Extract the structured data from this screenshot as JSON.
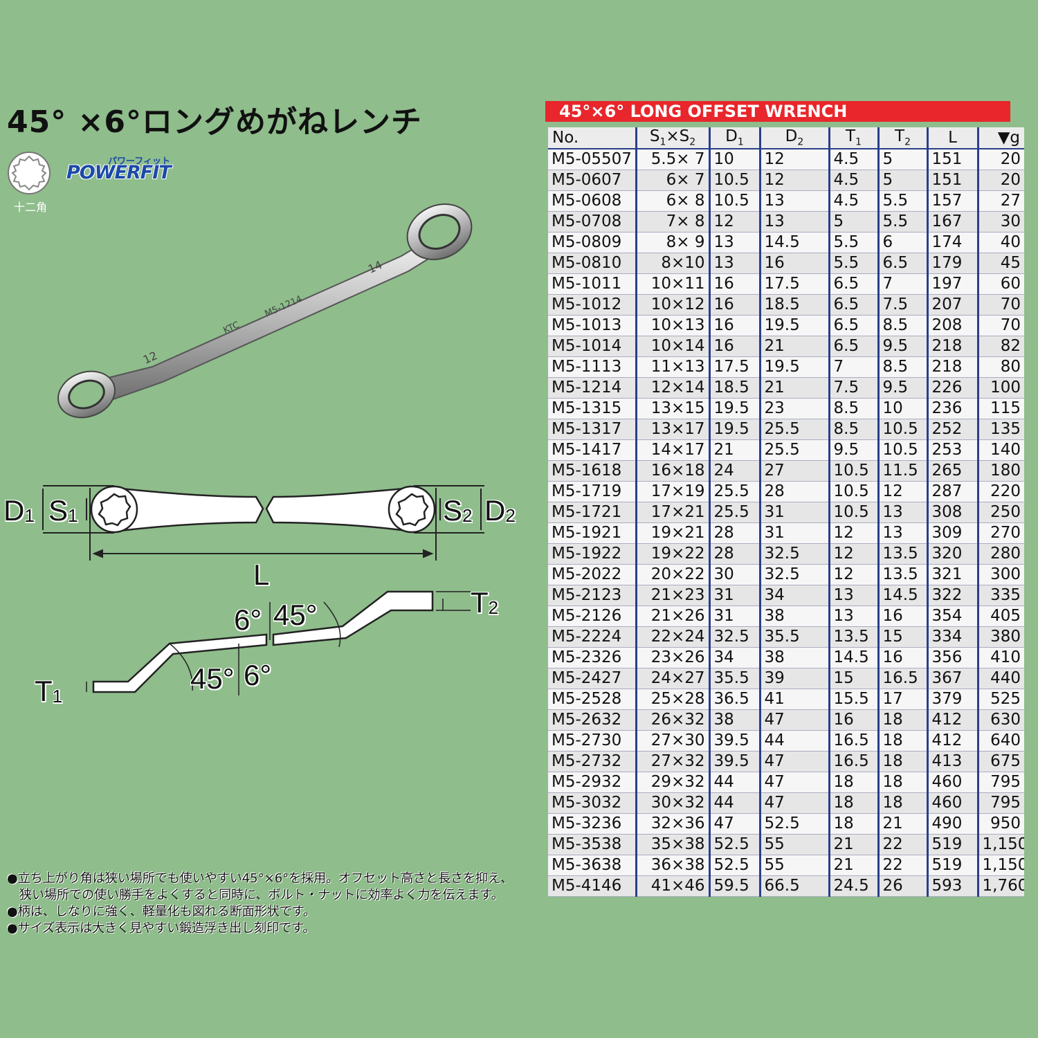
{
  "title": "45° ×6°ロングめがねレンチ",
  "twelve_point_label": "十二角",
  "brand": {
    "name": "POWERFIT",
    "kana": "パワーフィット"
  },
  "photo_markings": {
    "small_end": "12",
    "large_end": "14",
    "brand": "KTC",
    "model": "M5-1214"
  },
  "diagram": {
    "D1": "D",
    "D1_sub": "1",
    "S1": "S",
    "S1_sub": "1",
    "S2": "S",
    "S2_sub": "2",
    "D2": "D",
    "D2_sub": "2",
    "L": "L",
    "T1": "T",
    "T1_sub": "1",
    "T2": "T",
    "T2_sub": "2",
    "angle_6_top": "6°",
    "angle_45_top": "45°",
    "angle_45_bottom": "45°",
    "angle_6_bottom": "6°"
  },
  "notes": [
    "●立ち上がり角は狭い場所でも使いやすい45°×6°を採用。オフセット高さと長さを抑え、",
    "　狭い場所での使い勝手をよくすると同時に、ボルト・ナットに効率よく力を伝えます。",
    "●柄は、しなりに強く、軽量化も図れる断面形状です。",
    "●サイズ表示は大きく見やすい鍛造浮き出し刻印です。"
  ],
  "spec": {
    "header": "45°×6° LONG OFFSET WRENCH",
    "columns": [
      {
        "main": "No.",
        "sub": ""
      },
      {
        "main": "S",
        "sub": "1",
        "main2": "×S",
        "sub2": "2"
      },
      {
        "main": "D",
        "sub": "1"
      },
      {
        "main": "D",
        "sub": "2"
      },
      {
        "main": "T",
        "sub": "1"
      },
      {
        "main": "T",
        "sub": "2"
      },
      {
        "main": "L",
        "sub": ""
      },
      {
        "main": "▼g",
        "sub": ""
      }
    ],
    "rows": [
      [
        "M5-05507",
        "5.5× 7",
        "10",
        "12",
        "4.5",
        "5",
        "151",
        "20"
      ],
      [
        "M5-0607",
        "6× 7",
        "10.5",
        "12",
        "4.5",
        "5",
        "151",
        "20"
      ],
      [
        "M5-0608",
        "6× 8",
        "10.5",
        "13",
        "4.5",
        "5.5",
        "157",
        "27"
      ],
      [
        "M5-0708",
        "7× 8",
        "12",
        "13",
        "5",
        "5.5",
        "167",
        "30"
      ],
      [
        "M5-0809",
        "8× 9",
        "13",
        "14.5",
        "5.5",
        "6",
        "174",
        "40"
      ],
      [
        "M5-0810",
        "8×10",
        "13",
        "16",
        "5.5",
        "6.5",
        "179",
        "45"
      ],
      [
        "M5-1011",
        "10×11",
        "16",
        "17.5",
        "6.5",
        "7",
        "197",
        "60"
      ],
      [
        "M5-1012",
        "10×12",
        "16",
        "18.5",
        "6.5",
        "7.5",
        "207",
        "70"
      ],
      [
        "M5-1013",
        "10×13",
        "16",
        "19.5",
        "6.5",
        "8.5",
        "208",
        "70"
      ],
      [
        "M5-1014",
        "10×14",
        "16",
        "21",
        "6.5",
        "9.5",
        "218",
        "82"
      ],
      [
        "M5-1113",
        "11×13",
        "17.5",
        "19.5",
        "7",
        "8.5",
        "218",
        "80"
      ],
      [
        "M5-1214",
        "12×14",
        "18.5",
        "21",
        "7.5",
        "9.5",
        "226",
        "100"
      ],
      [
        "M5-1315",
        "13×15",
        "19.5",
        "23",
        "8.5",
        "10",
        "236",
        "115"
      ],
      [
        "M5-1317",
        "13×17",
        "19.5",
        "25.5",
        "8.5",
        "10.5",
        "252",
        "135"
      ],
      [
        "M5-1417",
        "14×17",
        "21",
        "25.5",
        "9.5",
        "10.5",
        "253",
        "140"
      ],
      [
        "M5-1618",
        "16×18",
        "24",
        "27",
        "10.5",
        "11.5",
        "265",
        "180"
      ],
      [
        "M5-1719",
        "17×19",
        "25.5",
        "28",
        "10.5",
        "12",
        "287",
        "220"
      ],
      [
        "M5-1721",
        "17×21",
        "25.5",
        "31",
        "10.5",
        "13",
        "308",
        "250"
      ],
      [
        "M5-1921",
        "19×21",
        "28",
        "31",
        "12",
        "13",
        "309",
        "270"
      ],
      [
        "M5-1922",
        "19×22",
        "28",
        "32.5",
        "12",
        "13.5",
        "320",
        "280"
      ],
      [
        "M5-2022",
        "20×22",
        "30",
        "32.5",
        "12",
        "13.5",
        "321",
        "300"
      ],
      [
        "M5-2123",
        "21×23",
        "31",
        "34",
        "13",
        "14.5",
        "322",
        "335"
      ],
      [
        "M5-2126",
        "21×26",
        "31",
        "38",
        "13",
        "16",
        "354",
        "405"
      ],
      [
        "M5-2224",
        "22×24",
        "32.5",
        "35.5",
        "13.5",
        "15",
        "334",
        "380"
      ],
      [
        "M5-2326",
        "23×26",
        "34",
        "38",
        "14.5",
        "16",
        "356",
        "410"
      ],
      [
        "M5-2427",
        "24×27",
        "35.5",
        "39",
        "15",
        "16.5",
        "367",
        "440"
      ],
      [
        "M5-2528",
        "25×28",
        "36.5",
        "41",
        "15.5",
        "17",
        "379",
        "525"
      ],
      [
        "M5-2632",
        "26×32",
        "38",
        "47",
        "16",
        "18",
        "412",
        "630"
      ],
      [
        "M5-2730",
        "27×30",
        "39.5",
        "44",
        "16.5",
        "18",
        "412",
        "640"
      ],
      [
        "M5-2732",
        "27×32",
        "39.5",
        "47",
        "16.5",
        "18",
        "413",
        "675"
      ],
      [
        "M5-2932",
        "29×32",
        "44",
        "47",
        "18",
        "18",
        "460",
        "795"
      ],
      [
        "M5-3032",
        "30×32",
        "44",
        "47",
        "18",
        "18",
        "460",
        "795"
      ],
      [
        "M5-3236",
        "32×36",
        "47",
        "52.5",
        "18",
        "21",
        "490",
        "950"
      ],
      [
        "M5-3538",
        "35×38",
        "52.5",
        "55",
        "21",
        "22",
        "519",
        "1,150"
      ],
      [
        "M5-3638",
        "36×38",
        "52.5",
        "55",
        "21",
        "22",
        "519",
        "1,150"
      ],
      [
        "M5-4146",
        "41×46",
        "59.5",
        "66.5",
        "24.5",
        "26",
        "593",
        "1,760"
      ]
    ]
  }
}
